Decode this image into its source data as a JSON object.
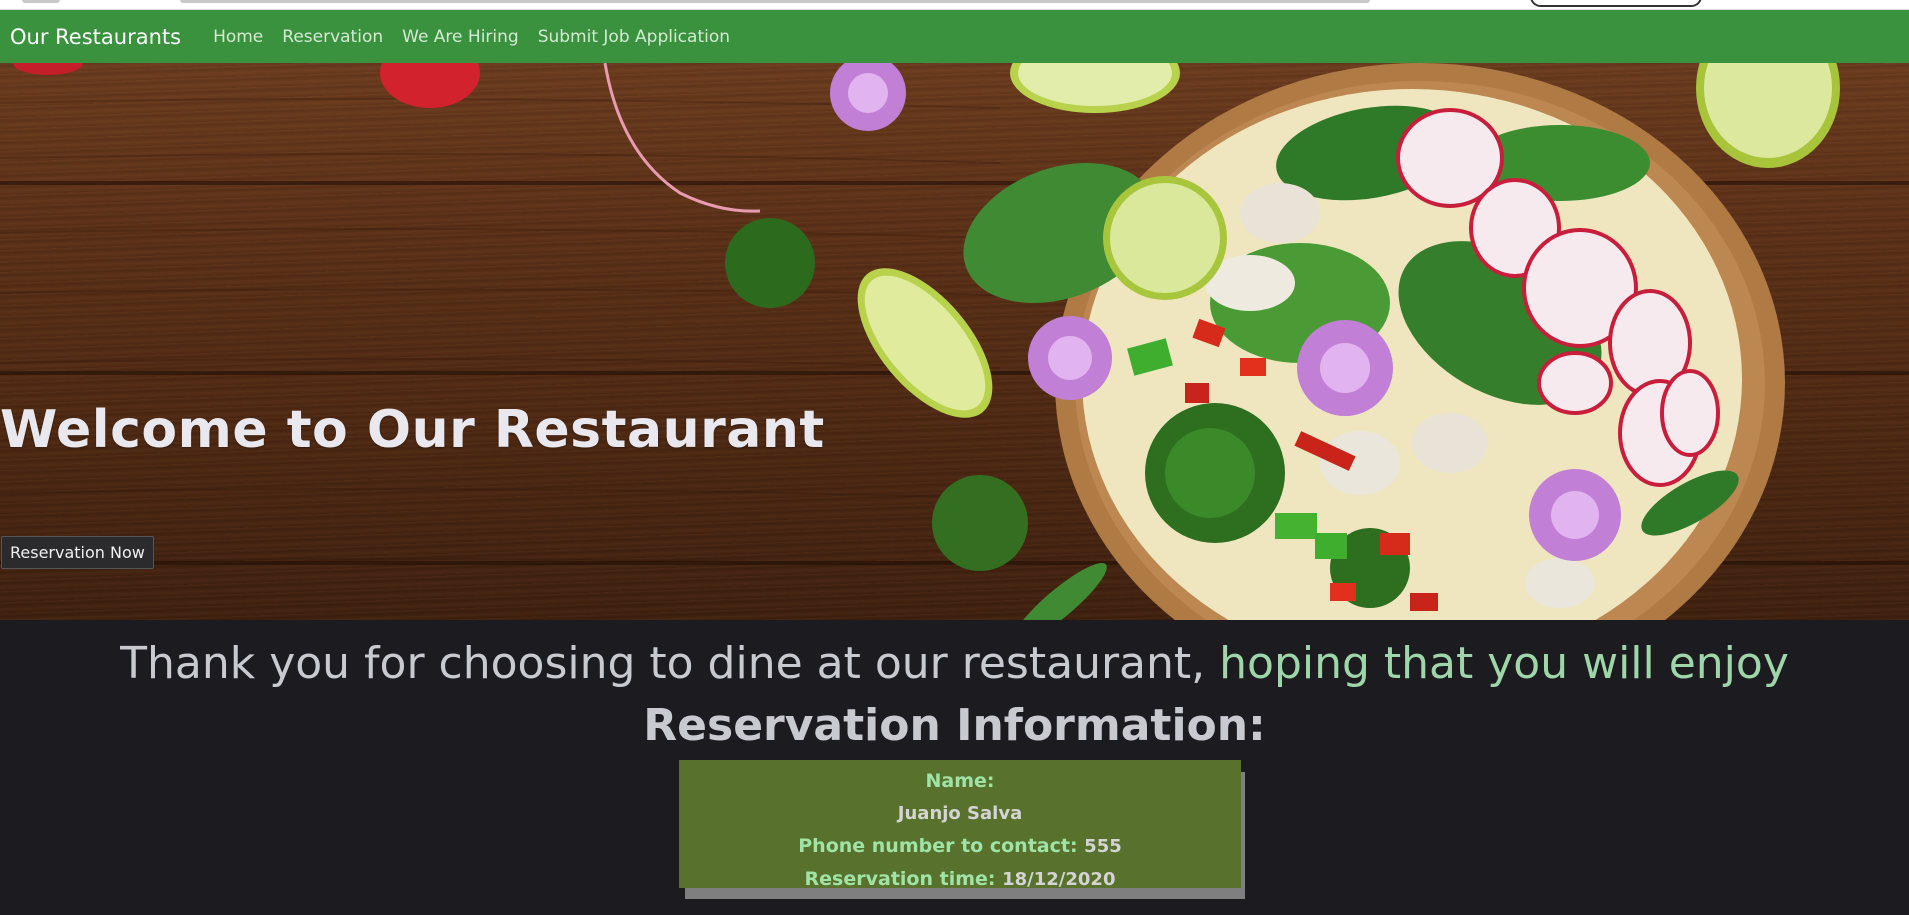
{
  "navbar": {
    "brand": "Our Restaurants",
    "links": [
      "Home",
      "Reservation",
      "We Are Hiring",
      "Submit Job Application"
    ]
  },
  "hero": {
    "title": "Welcome to Our Restaurant",
    "button_label": "Reservation Now"
  },
  "thank_you": {
    "text": "Thank you for choosing to dine at our restaurant,",
    "accent": "hoping that you will enjoy"
  },
  "reservation": {
    "heading": "Reservation Information:",
    "name_label": "Name:",
    "name_value": "Juanjo Salva",
    "phone_label": "Phone number to contact:",
    "phone_value": "555",
    "time_label": "Reservation time:",
    "time_value": "18/12/2020"
  },
  "colors": {
    "navbar": "#3a913e",
    "page_bg": "#1c1c20",
    "card_bg": "#58712c",
    "accent_green": "#9fd6a9"
  }
}
